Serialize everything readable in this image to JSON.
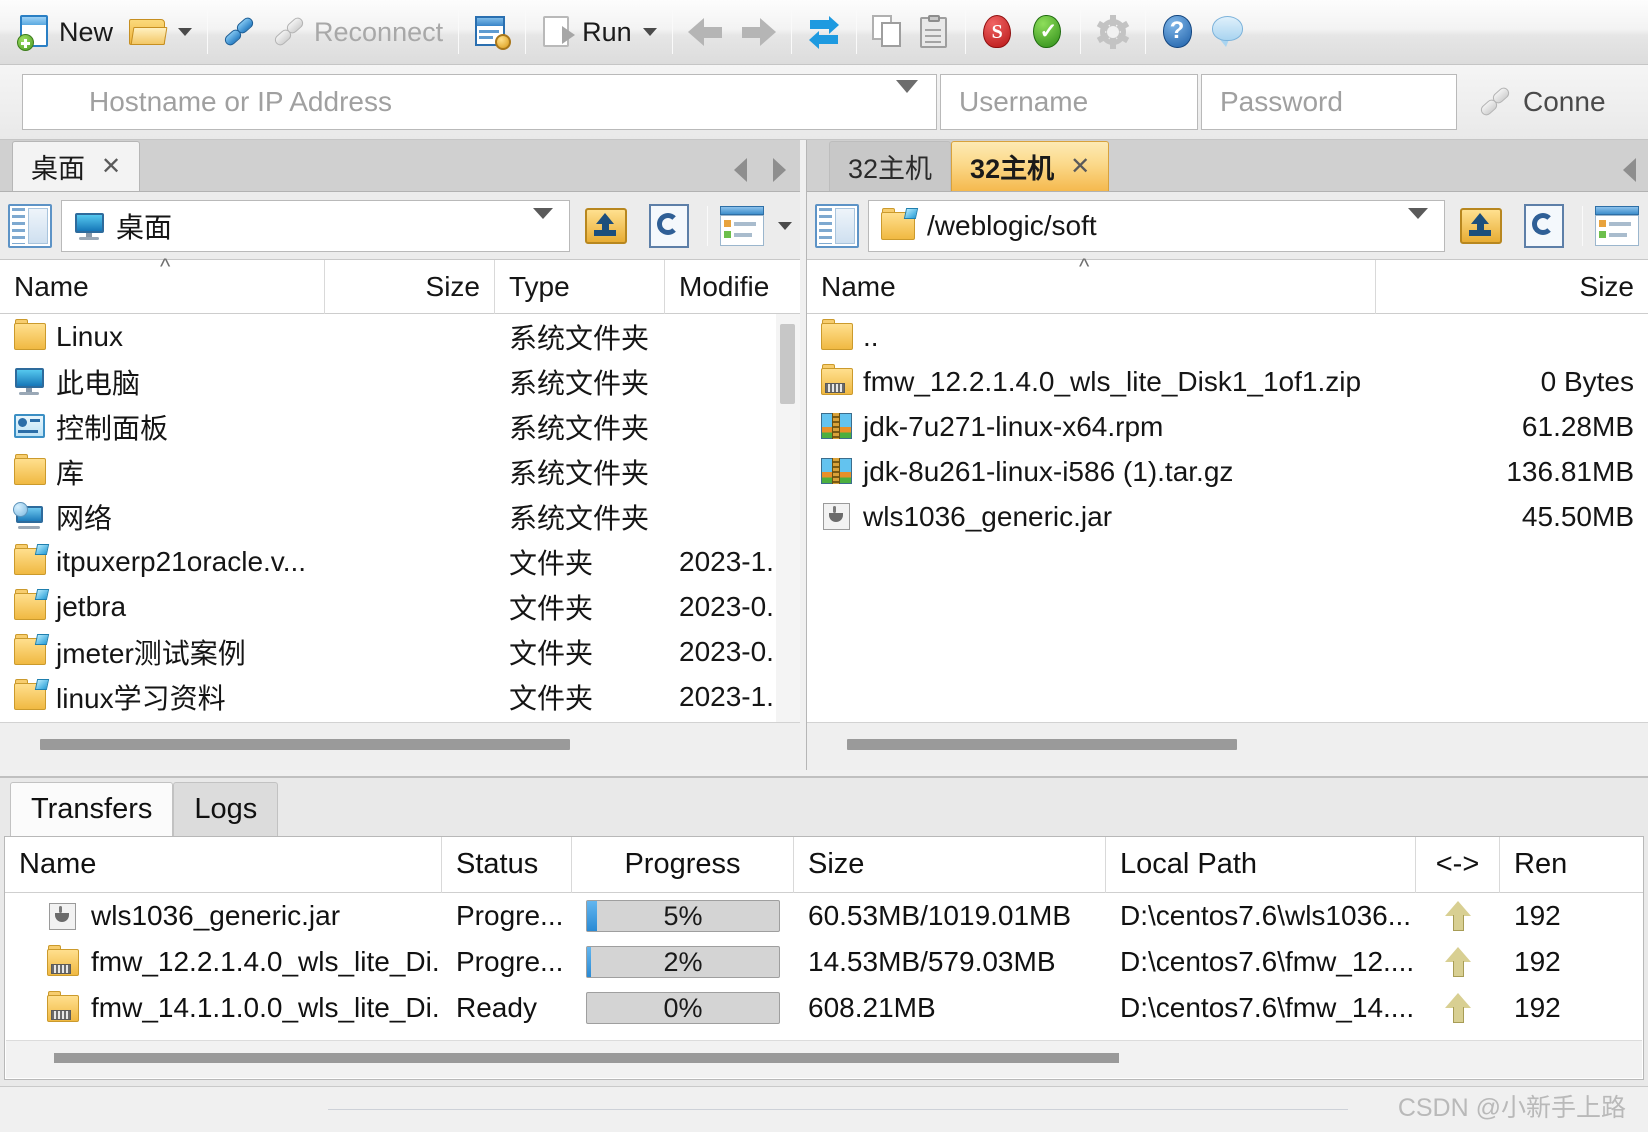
{
  "toolbar": {
    "new_label": "New",
    "reconnect_label": "Reconnect",
    "run_label": "Run",
    "items": [
      {
        "name": "new-session-button",
        "label": "New",
        "icon": "new-document-icon"
      },
      {
        "name": "open-folder-button",
        "label": "",
        "icon": "open-folder-icon"
      },
      {
        "name": "connect-button",
        "label": "",
        "icon": "plug-connect-icon"
      },
      {
        "name": "reconnect-button",
        "label": "Reconnect",
        "icon": "plug-disconnect-icon"
      },
      {
        "name": "session-settings-button",
        "label": "",
        "icon": "window-gear-icon"
      },
      {
        "name": "run-button",
        "label": "Run",
        "icon": "run-document-icon"
      },
      {
        "name": "back-button",
        "label": "",
        "icon": "arrow-left-icon"
      },
      {
        "name": "forward-button",
        "label": "",
        "icon": "arrow-right-icon"
      },
      {
        "name": "sync-browsing-button",
        "label": "",
        "icon": "sync-arrows-icon"
      },
      {
        "name": "copy-button",
        "label": "",
        "icon": "copy-icon"
      },
      {
        "name": "paste-button",
        "label": "",
        "icon": "paste-icon"
      },
      {
        "name": "red-tool-button",
        "label": "",
        "icon": "red-badge-icon"
      },
      {
        "name": "green-tool-button",
        "label": "",
        "icon": "green-badge-icon"
      },
      {
        "name": "options-button",
        "label": "",
        "icon": "gear-icon"
      },
      {
        "name": "help-button",
        "label": "",
        "icon": "help-circle-icon"
      },
      {
        "name": "feedback-button",
        "label": "",
        "icon": "chat-bubble-icon"
      }
    ]
  },
  "connect_bar": {
    "host_placeholder": "Hostname or IP Address",
    "host_value": "",
    "username_placeholder": "Username",
    "username_value": "",
    "password_placeholder": "Password",
    "password_value": "",
    "connect_label": "Conne"
  },
  "left_panel": {
    "tabs": [
      {
        "label": "桌面",
        "active": true,
        "closable": true
      }
    ],
    "path_value": "桌面",
    "columns": [
      "Name",
      "Size",
      "Type",
      "Modifie"
    ],
    "sort_column": "Name",
    "sort_direction": "asc",
    "rows": [
      {
        "icon": "folder-icon",
        "name": "Linux",
        "size": "",
        "type": "系统文件夹",
        "modified": ""
      },
      {
        "icon": "computer-icon",
        "name": "此电脑",
        "size": "",
        "type": "系统文件夹",
        "modified": ""
      },
      {
        "icon": "control-panel-icon",
        "name": "控制面板",
        "size": "",
        "type": "系统文件夹",
        "modified": ""
      },
      {
        "icon": "folder-icon",
        "name": "库",
        "size": "",
        "type": "系统文件夹",
        "modified": ""
      },
      {
        "icon": "network-icon",
        "name": "网络",
        "size": "",
        "type": "系统文件夹",
        "modified": ""
      },
      {
        "icon": "folder-shortcut-icon",
        "name": "itpuxerp21oracle.v...",
        "size": "",
        "type": "文件夹",
        "modified": "2023-1."
      },
      {
        "icon": "folder-shortcut-icon",
        "name": "jetbra",
        "size": "",
        "type": "文件夹",
        "modified": "2023-0."
      },
      {
        "icon": "folder-shortcut-icon",
        "name": "jmeter测试案例",
        "size": "",
        "type": "文件夹",
        "modified": "2023-0."
      },
      {
        "icon": "folder-shortcut-icon",
        "name": "linux学习资料",
        "size": "",
        "type": "文件夹",
        "modified": "2023-1."
      }
    ]
  },
  "right_panel": {
    "tabs": [
      {
        "label": "32主机",
        "active": false,
        "closable": false
      },
      {
        "label": "32主机",
        "active": true,
        "closable": true
      }
    ],
    "path_value": "/weblogic/soft",
    "columns": [
      "Name",
      "Size"
    ],
    "sort_column": "Name",
    "sort_direction": "asc",
    "rows": [
      {
        "icon": "folder-icon",
        "name": "..",
        "size": ""
      },
      {
        "icon": "zip-folder-icon",
        "name": "fmw_12.2.1.4.0_wls_lite_Disk1_1of1.zip",
        "size": "0 Bytes"
      },
      {
        "icon": "archive-icon",
        "name": "jdk-7u271-linux-x64.rpm",
        "size": "61.28MB"
      },
      {
        "icon": "archive-icon",
        "name": "jdk-8u261-linux-i586 (1).tar.gz",
        "size": "136.81MB"
      },
      {
        "icon": "jar-icon",
        "name": "wls1036_generic.jar",
        "size": "45.50MB"
      }
    ]
  },
  "transfers_panel": {
    "tabs": [
      {
        "label": "Transfers",
        "active": true
      },
      {
        "label": "Logs",
        "active": false
      }
    ],
    "columns": [
      "Name",
      "Status",
      "Progress",
      "Size",
      "Local Path",
      "<->",
      "Ren"
    ],
    "rows": [
      {
        "icon": "jar-icon",
        "name": "wls1036_generic.jar",
        "status": "Progre...",
        "progress": 5,
        "progress_label": "5%",
        "size": "60.53MB/1019.01MB",
        "local_path": "D:\\centos7.6\\wls1036...",
        "direction": "upload-arrow-icon",
        "remote": "192"
      },
      {
        "icon": "zip-folder-icon",
        "name": "fmw_12.2.1.4.0_wls_lite_Di...",
        "status": "Progre...",
        "progress": 2,
        "progress_label": "2%",
        "size": "14.53MB/579.03MB",
        "local_path": "D:\\centos7.6\\fmw_12....",
        "direction": "upload-arrow-icon",
        "remote": "192"
      },
      {
        "icon": "zip-folder-icon",
        "name": "fmw_14.1.1.0.0_wls_lite_Di...",
        "status": "Ready",
        "progress": 0,
        "progress_label": "0%",
        "size": "608.21MB",
        "local_path": "D:\\centos7.6\\fmw_14....",
        "direction": "upload-arrow-icon",
        "remote": "192"
      }
    ]
  },
  "watermark": "CSDN @小新手上路",
  "colors": {
    "active_tab_orange": "#f5b94e",
    "progress_fill": "#2a8ad4",
    "folder_yellow": "#f0b942",
    "accent_blue": "#2a7fc4"
  }
}
